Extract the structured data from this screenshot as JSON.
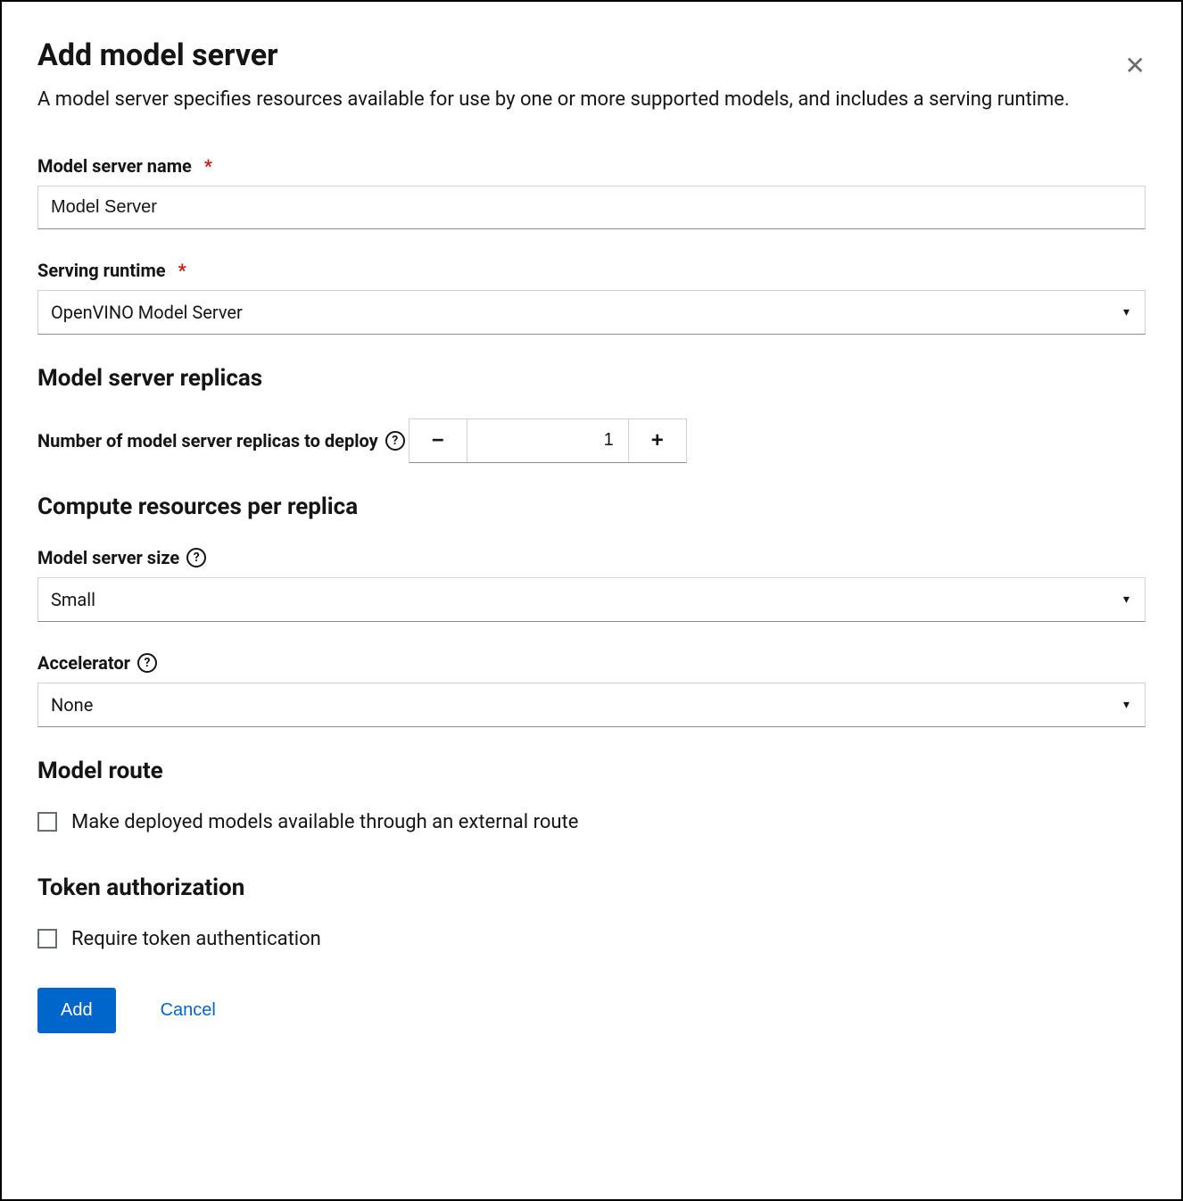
{
  "header": {
    "title": "Add model server",
    "description": "A model server specifies resources available for use by one or more supported models, and includes a serving runtime."
  },
  "fields": {
    "name_label": "Model server name",
    "name_value": "Model Server",
    "runtime_label": "Serving runtime",
    "runtime_value": "OpenVINO Model Server"
  },
  "replicas": {
    "section_title": "Model server replicas",
    "count_label": "Number of model server replicas to deploy",
    "count_value": "1"
  },
  "compute": {
    "section_title": "Compute resources per replica",
    "size_label": "Model server size",
    "size_value": "Small",
    "accel_label": "Accelerator",
    "accel_value": "None"
  },
  "route": {
    "section_title": "Model route",
    "checkbox_label": "Make deployed models available through an external route"
  },
  "auth": {
    "section_title": "Token authorization",
    "checkbox_label": "Require token authentication"
  },
  "actions": {
    "primary": "Add",
    "cancel": "Cancel"
  },
  "glyphs": {
    "help": "?",
    "minus": "−",
    "plus": "+",
    "caret": "▾",
    "close": "✕"
  }
}
